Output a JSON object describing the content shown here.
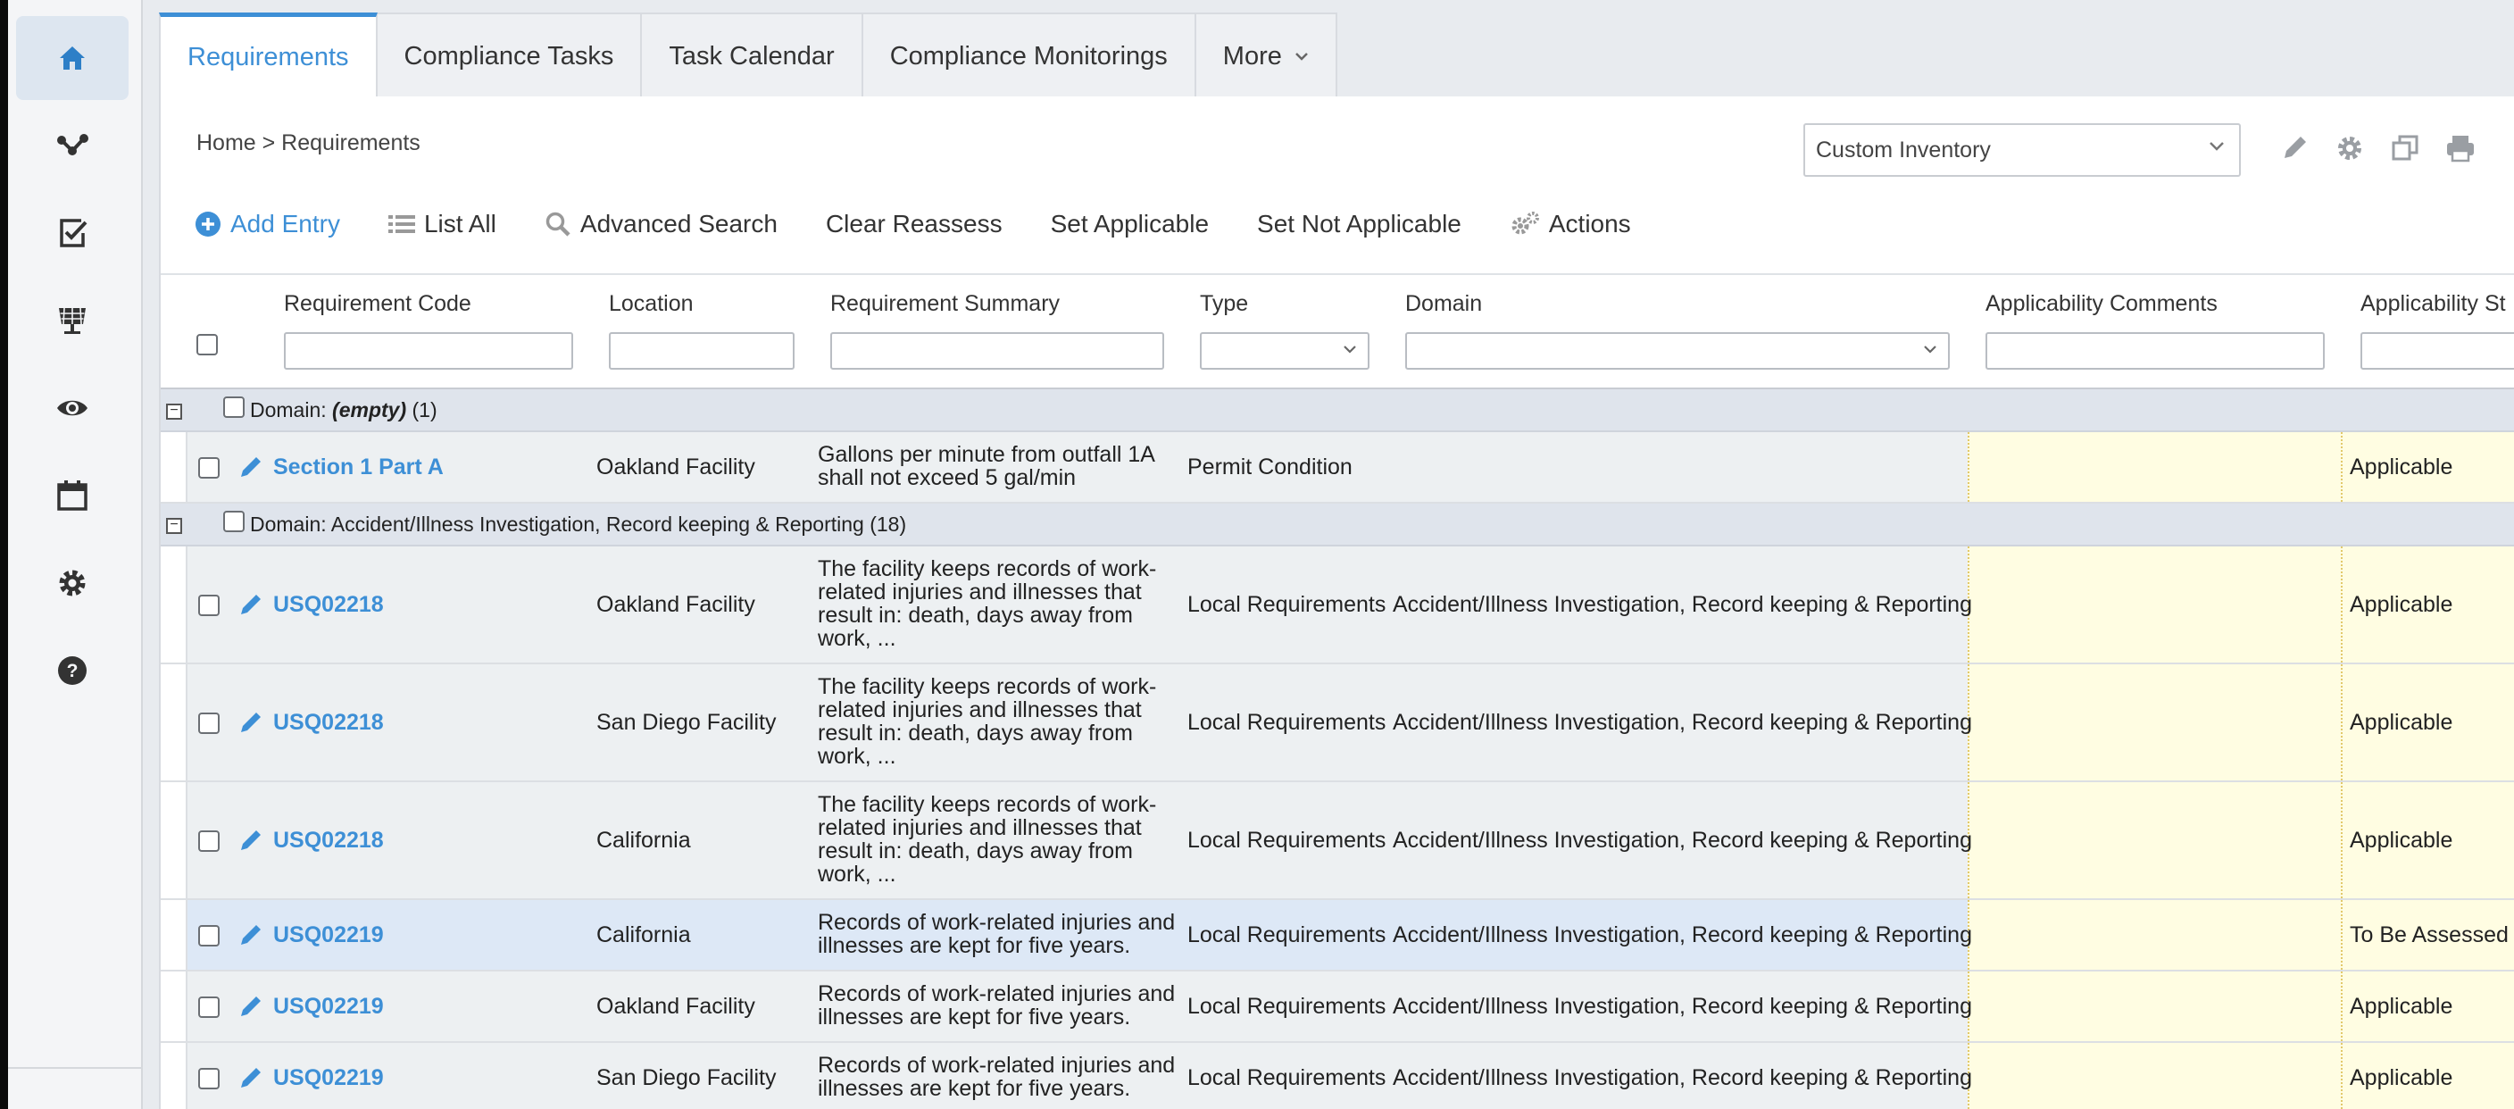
{
  "sidebar": {
    "items": [
      {
        "icon": "home-icon",
        "active": true
      },
      {
        "icon": "network-icon"
      },
      {
        "icon": "checklist-icon"
      },
      {
        "icon": "solar-panel-icon"
      },
      {
        "icon": "eye-icon"
      },
      {
        "icon": "calendar-icon"
      },
      {
        "icon": "gear-icon"
      },
      {
        "icon": "help-icon"
      }
    ]
  },
  "tabs": [
    {
      "label": "Requirements",
      "active": true
    },
    {
      "label": "Compliance Tasks"
    },
    {
      "label": "Task Calendar"
    },
    {
      "label": "Compliance Monitorings"
    },
    {
      "label": "More"
    }
  ],
  "breadcrumb": "Home > Requirements",
  "inventory_select": {
    "value": "Custom Inventory"
  },
  "toolbar": {
    "add_entry": "Add Entry",
    "list_all": "List All",
    "advanced_search": "Advanced Search",
    "clear_reassess": "Clear Reassess",
    "set_applicable": "Set Applicable",
    "set_not_applicable": "Set Not Applicable",
    "actions": "Actions"
  },
  "columns": {
    "code": "Requirement Code",
    "location": "Location",
    "summary": "Requirement Summary",
    "type": "Type",
    "domain": "Domain",
    "comments": "Applicability Comments",
    "status": "Applicability St"
  },
  "groups": [
    {
      "prefix": "Domain:",
      "name": "(empty)",
      "count": "(1)"
    },
    {
      "prefix": "Domain:",
      "name": "Accident/Illness Investigation, Record keeping & Reporting",
      "count": "(18)"
    }
  ],
  "rows": [
    {
      "code": "Section 1 Part A",
      "location": "Oakland Facility",
      "summary": "Gallons per minute from outfall 1A shall not exceed 5 gal/min",
      "type": "Permit Condition",
      "domain": "",
      "status": "Applicable"
    },
    {
      "code": "USQ02218",
      "location": "Oakland Facility",
      "summary": "The facility keeps records of work-related injuries and illnesses that result in: death, days away from work, ...",
      "type": "Local Requirements",
      "domain": "Accident/Illness Investigation, Record keeping & Reporting",
      "status": "Applicable"
    },
    {
      "code": "USQ02218",
      "location": "San Diego Facility",
      "summary": "The facility keeps records of work-related injuries and illnesses that result in: death, days away from work, ...",
      "type": "Local Requirements",
      "domain": "Accident/Illness Investigation, Record keeping & Reporting",
      "status": "Applicable"
    },
    {
      "code": "USQ02218",
      "location": "California",
      "summary": "The facility keeps records of work-related injuries and illnesses that result in: death, days away from work, ...",
      "type": "Local Requirements",
      "domain": "Accident/Illness Investigation, Record keeping & Reporting",
      "status": "Applicable"
    },
    {
      "code": "USQ02219",
      "location": "California",
      "summary": "Records of work-related injuries and illnesses are kept for five years.",
      "type": "Local Requirements",
      "domain": "Accident/Illness Investigation, Record keeping & Reporting",
      "status": "To Be Assessed"
    },
    {
      "code": "USQ02219",
      "location": "Oakland Facility",
      "summary": "Records of work-related injuries and illnesses are kept for five years.",
      "type": "Local Requirements",
      "domain": "Accident/Illness Investigation, Record keeping & Reporting",
      "status": "Applicable"
    },
    {
      "code": "USQ02219",
      "location": "San Diego Facility",
      "summary": "Records of work-related injuries and illnesses are kept for five years.",
      "type": "Local Requirements",
      "domain": "Accident/Illness Investigation, Record keeping & Reporting",
      "status": "Applicable"
    }
  ],
  "colors": {
    "accent": "#3d8fd6",
    "applicability_bg": "#fffde2",
    "selected_row": "#dde8f6"
  }
}
